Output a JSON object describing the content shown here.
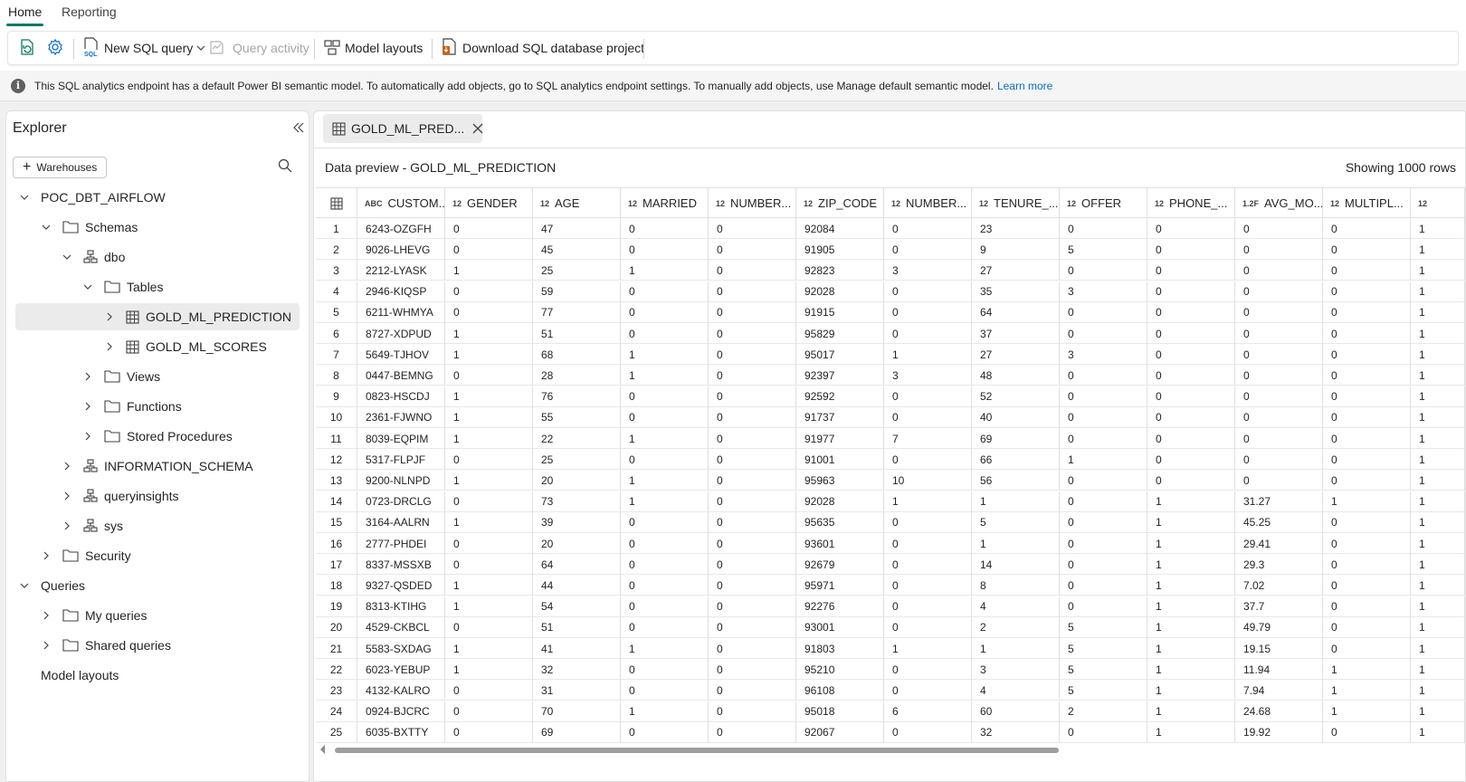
{
  "top_tabs": [
    "Home",
    "Reporting"
  ],
  "ribbon": {
    "new_sql_query": "New SQL query",
    "query_activity": "Query activity",
    "model_layouts": "Model layouts",
    "download_project": "Download SQL database project"
  },
  "infobar": {
    "text": "This SQL analytics endpoint has a default Power BI semantic model. To automatically add objects, go to SQL analytics endpoint settings. To manually add objects, use Manage default semantic model.",
    "link": "Learn more"
  },
  "explorer": {
    "title": "Explorer",
    "warehouses_button": "Warehouses",
    "tree": [
      {
        "label": "POC_DBT_AIRFLOW",
        "level": 0,
        "icon": "none",
        "chevron": "down"
      },
      {
        "label": "Schemas",
        "level": 1,
        "icon": "folder-icon",
        "chevron": "down"
      },
      {
        "label": "dbo",
        "level": 2,
        "icon": "schema-icon",
        "chevron": "down"
      },
      {
        "label": "Tables",
        "level": 3,
        "icon": "folder-icon",
        "chevron": "down"
      },
      {
        "label": "GOLD_ML_PREDICTION",
        "level": 4,
        "icon": "table-icon",
        "chevron": "right",
        "selected": true
      },
      {
        "label": "GOLD_ML_SCORES",
        "level": 4,
        "icon": "table-icon",
        "chevron": "right"
      },
      {
        "label": "Views",
        "level": 3,
        "icon": "folder-icon",
        "chevron": "right"
      },
      {
        "label": "Functions",
        "level": 3,
        "icon": "folder-icon",
        "chevron": "right"
      },
      {
        "label": "Stored Procedures",
        "level": 3,
        "icon": "folder-icon",
        "chevron": "right"
      },
      {
        "label": "INFORMATION_SCHEMA",
        "level": 2,
        "icon": "schema-icon",
        "chevron": "right"
      },
      {
        "label": "queryinsights",
        "level": 2,
        "icon": "schema-icon",
        "chevron": "right"
      },
      {
        "label": "sys",
        "level": 2,
        "icon": "schema-icon",
        "chevron": "right"
      },
      {
        "label": "Security",
        "level": 1,
        "icon": "folder-icon",
        "chevron": "right"
      },
      {
        "label": "Queries",
        "level": 0,
        "icon": "none",
        "chevron": "down"
      },
      {
        "label": "My queries",
        "level": 1,
        "icon": "folder-icon",
        "chevron": "right"
      },
      {
        "label": "Shared queries",
        "level": 1,
        "icon": "folder-icon",
        "chevron": "right"
      },
      {
        "label": "Model layouts",
        "level": 0,
        "icon": "none",
        "chevron": "none",
        "bold": true
      }
    ]
  },
  "document_tab": {
    "label": "GOLD_ML_PRED..."
  },
  "preview": {
    "title": "Data preview - GOLD_ML_PREDICTION",
    "row_count": "Showing 1000 rows"
  },
  "grid": {
    "columns": [
      {
        "type": "ABC",
        "name": "CUSTOM..."
      },
      {
        "type": "12",
        "name": "GENDER"
      },
      {
        "type": "12",
        "name": "AGE"
      },
      {
        "type": "12",
        "name": "MARRIED"
      },
      {
        "type": "12",
        "name": "NUMBER..."
      },
      {
        "type": "12",
        "name": "ZIP_CODE"
      },
      {
        "type": "12",
        "name": "NUMBER..."
      },
      {
        "type": "12",
        "name": "TENURE_..."
      },
      {
        "type": "12",
        "name": "OFFER"
      },
      {
        "type": "12",
        "name": "PHONE_..."
      },
      {
        "type": "1.2F",
        "name": "AVG_MO..."
      },
      {
        "type": "12",
        "name": "MULTIPL..."
      },
      {
        "type": "12",
        "name": ""
      }
    ],
    "rows": [
      [
        "1",
        "6243-OZGFH",
        "0",
        "47",
        "0",
        "0",
        "92084",
        "0",
        "23",
        "0",
        "0",
        "0",
        "0",
        "1"
      ],
      [
        "2",
        "9026-LHEVG",
        "0",
        "45",
        "0",
        "0",
        "91905",
        "0",
        "9",
        "5",
        "0",
        "0",
        "0",
        "1"
      ],
      [
        "3",
        "2212-LYASK",
        "1",
        "25",
        "1",
        "0",
        "92823",
        "3",
        "27",
        "0",
        "0",
        "0",
        "0",
        "1"
      ],
      [
        "4",
        "2946-KIQSP",
        "0",
        "59",
        "0",
        "0",
        "92028",
        "0",
        "35",
        "3",
        "0",
        "0",
        "0",
        "1"
      ],
      [
        "5",
        "6211-WHMYA",
        "0",
        "77",
        "0",
        "0",
        "91915",
        "0",
        "64",
        "0",
        "0",
        "0",
        "0",
        "1"
      ],
      [
        "6",
        "8727-XDPUD",
        "1",
        "51",
        "0",
        "0",
        "95829",
        "0",
        "37",
        "0",
        "0",
        "0",
        "0",
        "1"
      ],
      [
        "7",
        "5649-TJHOV",
        "1",
        "68",
        "1",
        "0",
        "95017",
        "1",
        "27",
        "3",
        "0",
        "0",
        "0",
        "1"
      ],
      [
        "8",
        "0447-BEMNG",
        "0",
        "28",
        "1",
        "0",
        "92397",
        "3",
        "48",
        "0",
        "0",
        "0",
        "0",
        "1"
      ],
      [
        "9",
        "0823-HSCDJ",
        "1",
        "76",
        "0",
        "0",
        "92592",
        "0",
        "52",
        "0",
        "0",
        "0",
        "0",
        "1"
      ],
      [
        "10",
        "2361-FJWNO",
        "1",
        "55",
        "0",
        "0",
        "91737",
        "0",
        "40",
        "0",
        "0",
        "0",
        "0",
        "1"
      ],
      [
        "11",
        "8039-EQPIM",
        "1",
        "22",
        "1",
        "0",
        "91977",
        "7",
        "69",
        "0",
        "0",
        "0",
        "0",
        "1"
      ],
      [
        "12",
        "5317-FLPJF",
        "0",
        "25",
        "0",
        "0",
        "91001",
        "0",
        "66",
        "1",
        "0",
        "0",
        "0",
        "1"
      ],
      [
        "13",
        "9200-NLNPD",
        "1",
        "20",
        "1",
        "0",
        "95963",
        "10",
        "56",
        "0",
        "0",
        "0",
        "0",
        "1"
      ],
      [
        "14",
        "0723-DRCLG",
        "0",
        "73",
        "1",
        "0",
        "92028",
        "1",
        "1",
        "0",
        "1",
        "31.27",
        "1",
        "1"
      ],
      [
        "15",
        "3164-AALRN",
        "1",
        "39",
        "0",
        "0",
        "95635",
        "0",
        "5",
        "0",
        "1",
        "45.25",
        "0",
        "1"
      ],
      [
        "16",
        "2777-PHDEI",
        "0",
        "20",
        "0",
        "0",
        "93601",
        "0",
        "1",
        "0",
        "1",
        "29.41",
        "0",
        "1"
      ],
      [
        "17",
        "8337-MSSXB",
        "0",
        "64",
        "0",
        "0",
        "92679",
        "0",
        "14",
        "0",
        "1",
        "29.3",
        "0",
        "1"
      ],
      [
        "18",
        "9327-QSDED",
        "1",
        "44",
        "0",
        "0",
        "95971",
        "0",
        "8",
        "0",
        "1",
        "7.02",
        "0",
        "1"
      ],
      [
        "19",
        "8313-KTIHG",
        "1",
        "54",
        "0",
        "0",
        "92276",
        "0",
        "4",
        "0",
        "1",
        "37.7",
        "0",
        "1"
      ],
      [
        "20",
        "4529-CKBCL",
        "0",
        "51",
        "0",
        "0",
        "93001",
        "0",
        "2",
        "5",
        "1",
        "49.79",
        "0",
        "1"
      ],
      [
        "21",
        "5583-SXDAG",
        "1",
        "41",
        "1",
        "0",
        "91803",
        "1",
        "1",
        "5",
        "1",
        "19.15",
        "0",
        "1"
      ],
      [
        "22",
        "6023-YEBUP",
        "1",
        "32",
        "0",
        "0",
        "95210",
        "0",
        "3",
        "5",
        "1",
        "11.94",
        "1",
        "1"
      ],
      [
        "23",
        "4132-KALRO",
        "0",
        "31",
        "0",
        "0",
        "96108",
        "0",
        "4",
        "5",
        "1",
        "7.94",
        "1",
        "1"
      ],
      [
        "24",
        "0924-BJCRC",
        "0",
        "70",
        "1",
        "0",
        "95018",
        "6",
        "60",
        "2",
        "1",
        "24.68",
        "1",
        "1"
      ],
      [
        "25",
        "6035-BXTTY",
        "0",
        "69",
        "0",
        "0",
        "92067",
        "0",
        "32",
        "0",
        "1",
        "19.92",
        "0",
        "1"
      ]
    ]
  },
  "colors": {
    "accent": "#117865",
    "link": "#0f6cbd",
    "selected_row": "#ebebeb"
  }
}
